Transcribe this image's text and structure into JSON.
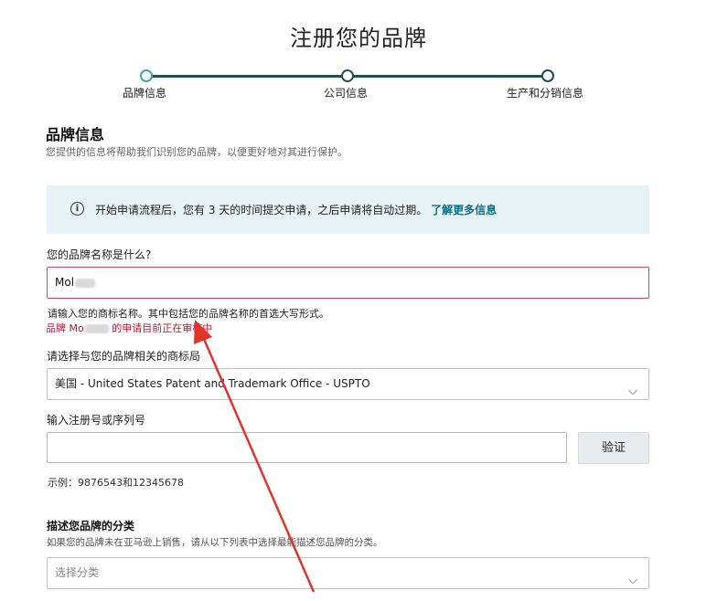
{
  "page_title": "注册您的品牌",
  "stepper": {
    "steps": [
      "品牌信息",
      "公司信息",
      "生产和分销信息"
    ]
  },
  "section": {
    "title": "品牌信息",
    "subtitle": "您提供的信息将帮助我们识别您的品牌，以便更好地对其进行保护。"
  },
  "notice": {
    "icon": "info-icon",
    "text": "开始申请流程后，您有 3 天的时间提交申请，之后申请将自动过期。",
    "link": "了解更多信息"
  },
  "brand_name": {
    "label": "您的品牌名称是什么?",
    "value": "Mol",
    "hint": "请输入您的商标名称。其中包括您的品牌名称的首选大写形式。",
    "error_prefix": "品牌 Mo",
    "error_suffix": " 的申请目前正在审核中"
  },
  "trademark_office": {
    "label": "请选择与您的品牌相关的商标局",
    "value": "美国 - United States Patent and Trademark Office - USPTO"
  },
  "registration": {
    "label": "输入注册号或序列号",
    "value": "",
    "verify_button": "验证",
    "example": "示例：9876543和12345678"
  },
  "category": {
    "title": "描述您品牌的分类",
    "subtitle": "如果您的品牌未在亚马逊上销售，请从以下列表中选择最能描述您品牌的分类。",
    "placeholder": "选择分类"
  },
  "colors": {
    "accent": "#0c6f84",
    "error": "#c8102e",
    "stepper": "#1f4f55",
    "notice_bg": "#e6f2f3",
    "arrow": "#e2332b"
  }
}
